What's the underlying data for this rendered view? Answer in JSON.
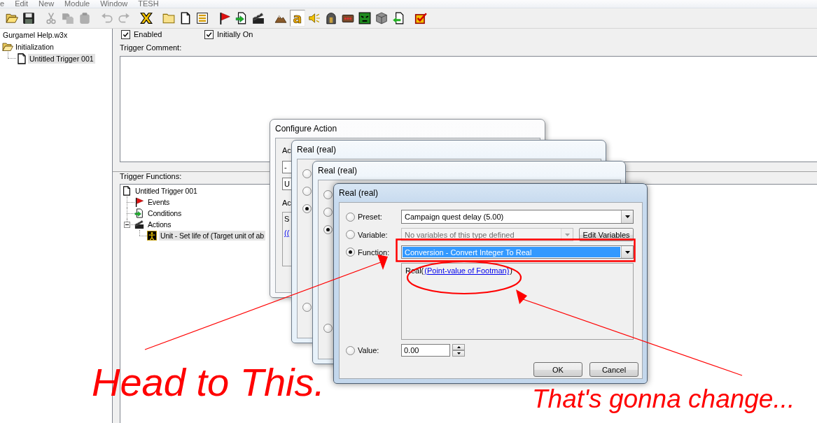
{
  "menu": [
    "e",
    "Edit",
    "New",
    "Module",
    "Window",
    "TESH"
  ],
  "toolbar": [
    {
      "buttons": [
        {
          "kind": "open",
          "disabled": false,
          "pressed": false
        },
        {
          "kind": "save",
          "disabled": false,
          "pressed": false
        }
      ]
    },
    {
      "buttons": [
        {
          "kind": "cut",
          "disabled": true,
          "pressed": false
        },
        {
          "kind": "copy",
          "disabled": true,
          "pressed": false
        },
        {
          "kind": "paste",
          "disabled": true,
          "pressed": false
        }
      ]
    },
    {
      "buttons": [
        {
          "kind": "undo",
          "disabled": true,
          "pressed": false
        },
        {
          "kind": "redo",
          "disabled": true,
          "pressed": false
        }
      ]
    },
    {
      "buttons": [
        {
          "kind": "x-mark",
          "disabled": false,
          "pressed": false
        }
      ]
    },
    {
      "buttons": [
        {
          "kind": "folder",
          "disabled": false,
          "pressed": false
        },
        {
          "kind": "document",
          "disabled": false,
          "pressed": false
        },
        {
          "kind": "lines",
          "disabled": false,
          "pressed": false
        }
      ]
    },
    {
      "buttons": [
        {
          "kind": "flag",
          "disabled": false,
          "pressed": false
        },
        {
          "kind": "document-arrow",
          "disabled": false,
          "pressed": false
        },
        {
          "kind": "clapperboard",
          "disabled": false,
          "pressed": false
        }
      ]
    },
    {
      "buttons": [
        {
          "kind": "mountain",
          "disabled": false,
          "pressed": false
        },
        {
          "kind": "glyph",
          "glyph": "a",
          "disabled": false,
          "pressed": true
        },
        {
          "kind": "speaker",
          "disabled": false,
          "pressed": false
        },
        {
          "kind": "helmet",
          "disabled": false,
          "pressed": false
        },
        {
          "kind": "panel",
          "disabled": false,
          "pressed": false
        },
        {
          "kind": "monster",
          "disabled": false,
          "pressed": false
        },
        {
          "kind": "cube",
          "disabled": false,
          "pressed": false
        },
        {
          "kind": "page-arrow",
          "disabled": false,
          "pressed": false
        }
      ]
    },
    {
      "buttons": [
        {
          "kind": "checkbox",
          "disabled": false,
          "pressed": false
        }
      ]
    }
  ],
  "map_tree": [
    {
      "label": "Gurgamel Help.w3x",
      "selected": false,
      "children": [
        {
          "label": "Initialization",
          "kind": "category",
          "selected": false,
          "children": [
            {
              "label": "Untitled Trigger 001",
              "kind": "trigger",
              "selected": true
            }
          ]
        }
      ]
    }
  ],
  "trigger": {
    "enabled": {
      "label": "Enabled",
      "checked": true
    },
    "initially_on": {
      "label": "Initially On",
      "checked": true
    },
    "comment_label": "Trigger Comment:",
    "functions_label": "Trigger Functions:",
    "functions_tree": [
      {
        "label": "Untitled Trigger 001",
        "kind": "trigger",
        "selected": false,
        "children": [
          {
            "label": "Events",
            "kind": "events",
            "selected": false
          },
          {
            "label": "Conditions",
            "kind": "conditions",
            "selected": false
          },
          {
            "label": "Actions",
            "kind": "actions",
            "selected": false,
            "expanded": true,
            "children": [
              {
                "label": "Unit - Set life of (Target unit of ab",
                "kind": "action",
                "selected": true
              }
            ]
          }
        ]
      }
    ]
  },
  "dialogs": [
    {
      "kind": "configure",
      "title": "Configure Action",
      "fragments": {
        "label_top": "Ac",
        "dropdown": "-",
        "field": "U",
        "label_bottom": "Ac",
        "panel_text": "S",
        "panel_link": "(("
      }
    },
    {
      "kind": "covered",
      "title": "Real (real)",
      "radios": [
        {
          "selected": false
        },
        {
          "selected": false
        },
        {
          "selected": true
        },
        {
          "selected": false
        }
      ]
    },
    {
      "kind": "covered",
      "title": "Real (real)",
      "radios": [
        {
          "selected": false
        },
        {
          "selected": false
        },
        {
          "selected": true
        },
        {
          "selected": false
        }
      ]
    },
    {
      "kind": "active",
      "title": "Real (real)",
      "options": [
        {
          "kind": "dropdown",
          "label": "Preset:",
          "value": "Campaign quest delay (5.00)",
          "selected": false,
          "disabled": false,
          "focused": false
        },
        {
          "kind": "dropdown",
          "label": "Variable:",
          "value": "No variables of this type defined",
          "selected": false,
          "disabled": true,
          "focused": false,
          "button": "Edit Variables"
        },
        {
          "kind": "dropdown",
          "label": "Function:",
          "value": "Conversion - Convert Integer To Real",
          "selected": true,
          "disabled": false,
          "focused": true,
          "description": {
            "prefix": "Real(",
            "link": "(Point-value of Footman)",
            "suffix": ")"
          }
        },
        {
          "kind": "spinner",
          "label": "Value:",
          "value": "0.00",
          "selected": false,
          "disabled": false,
          "focused": false
        }
      ],
      "buttons": [
        "OK",
        "Cancel"
      ]
    }
  ],
  "annotations": {
    "callouts": [
      "Head to This.",
      "That's gonna change..."
    ]
  }
}
